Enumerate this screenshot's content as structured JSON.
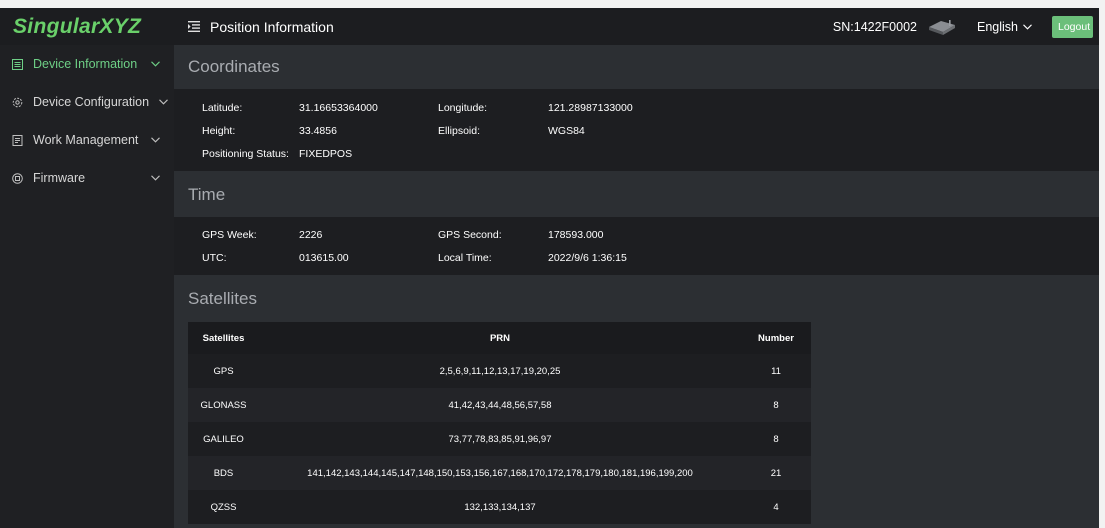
{
  "app": {
    "logo_text": "SingularXYZ",
    "page_title": "Position Information",
    "serial": "SN:1422F0002",
    "language": "English",
    "logout_label": "Logout",
    "accent_color": "#6ecf86"
  },
  "sidebar": {
    "items": [
      {
        "label": "Device Information",
        "icon": "list-icon",
        "active": true
      },
      {
        "label": "Device Configuration",
        "icon": "gear-icon",
        "active": false
      },
      {
        "label": "Work Management",
        "icon": "document-icon",
        "active": false
      },
      {
        "label": "Firmware",
        "icon": "chip-icon",
        "active": false
      }
    ]
  },
  "coordinates": {
    "title": "Coordinates",
    "latitude_label": "Latitude:",
    "latitude": "31.16653364000",
    "longitude_label": "Longitude:",
    "longitude": "121.28987133000",
    "height_label": "Height:",
    "height": "33.4856",
    "ellipsoid_label": "Ellipsoid:",
    "ellipsoid": "WGS84",
    "status_label": "Positioning Status:",
    "status": "FIXEDPOS"
  },
  "time": {
    "title": "Time",
    "gps_week_label": "GPS Week:",
    "gps_week": "2226",
    "gps_second_label": "GPS Second:",
    "gps_second": "178593.000",
    "utc_label": "UTC:",
    "utc": "013615.00",
    "local_time_label": "Local Time:",
    "local_time": "2022/9/6 1:36:15"
  },
  "satellites": {
    "title": "Satellites",
    "headers": [
      "Satellites",
      "PRN",
      "Number"
    ],
    "rows": [
      {
        "name": "GPS",
        "prn": "2,5,6,9,11,12,13,17,19,20,25",
        "number": "11"
      },
      {
        "name": "GLONASS",
        "prn": "41,42,43,44,48,56,57,58",
        "number": "8"
      },
      {
        "name": "GALILEO",
        "prn": "73,77,78,83,85,91,96,97",
        "number": "8"
      },
      {
        "name": "BDS",
        "prn": "141,142,143,144,145,147,148,150,153,156,167,168,170,172,178,179,180,181,196,199,200",
        "number": "21"
      },
      {
        "name": "QZSS",
        "prn": "132,133,134,137",
        "number": "4"
      }
    ]
  }
}
